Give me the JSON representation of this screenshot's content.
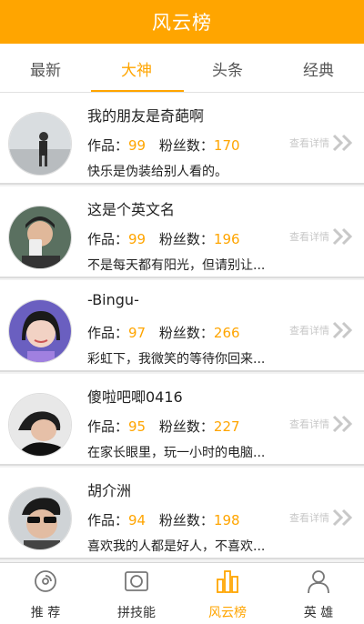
{
  "header": {
    "title": "风云榜"
  },
  "tabs": [
    {
      "label": "最新"
    },
    {
      "label": "大神"
    },
    {
      "label": "头条"
    },
    {
      "label": "经典"
    }
  ],
  "active_tab": "大神",
  "colors": {
    "accent": "#ffa500",
    "text": "#222222",
    "muted": "#c8c8c8"
  },
  "list": {
    "works_label": "作品：",
    "fans_label": "粉丝数：",
    "detail_label": "查看详情",
    "items": [
      {
        "name": "我的朋友是奇葩啊",
        "works": "99",
        "fans": "170",
        "motto": "快乐是伪装给别人看的。"
      },
      {
        "name": "这是个英文名",
        "works": "99",
        "fans": "196",
        "motto": "不是每天都有阳光，但请别让..."
      },
      {
        "name": "-Bingu-",
        "works": "97",
        "fans": "266",
        "motto": "彩虹下，我微笑的等待你回来..."
      },
      {
        "name": "傻啦吧唧0416",
        "works": "95",
        "fans": "227",
        "motto": "在家长眼里，玩一小时的电脑..."
      },
      {
        "name": "胡介洲",
        "works": "94",
        "fans": "198",
        "motto": "喜欢我的人都是好人，不喜欢..."
      }
    ]
  },
  "bottom_nav": [
    {
      "label": "推 荐",
      "icon": "target-icon"
    },
    {
      "label": "拼技能",
      "icon": "frame-icon"
    },
    {
      "label": "风云榜",
      "icon": "bar-chart-icon"
    },
    {
      "label": "英 雄",
      "icon": "person-icon"
    }
  ],
  "active_nav": "风云榜"
}
